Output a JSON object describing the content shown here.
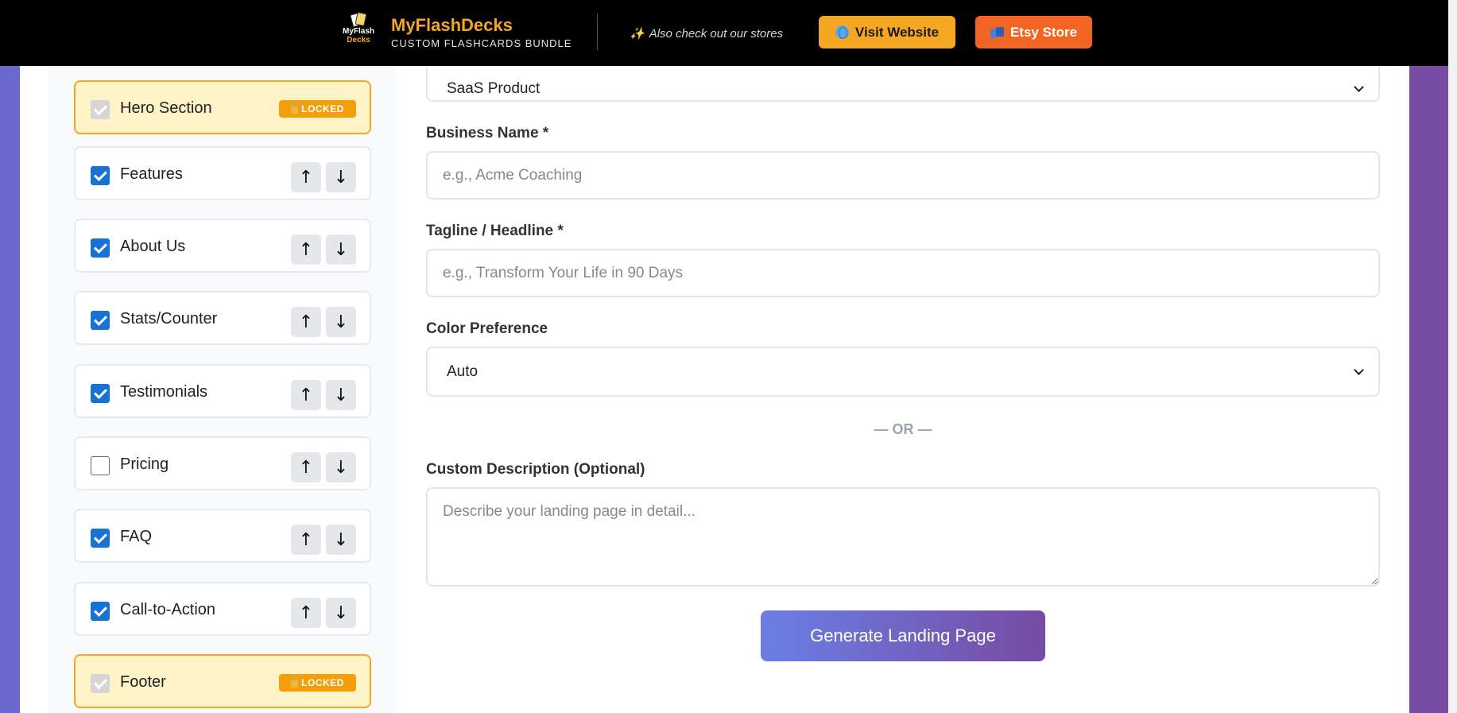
{
  "header": {
    "logo_line1": "MyFlash",
    "logo_line2": "Decks",
    "brand_name": "MyFlashDecks",
    "brand_sub": "CUSTOM FLASHCARDS BUNDLE",
    "also_check": "Also check out our stores",
    "visit_label": "Visit Website",
    "etsy_label": "Etsy Store"
  },
  "sections": [
    {
      "label": "Hero Section",
      "locked": true,
      "checked": true
    },
    {
      "label": "Features",
      "locked": false,
      "checked": true
    },
    {
      "label": "About Us",
      "locked": false,
      "checked": true
    },
    {
      "label": "Stats/Counter",
      "locked": false,
      "checked": true
    },
    {
      "label": "Testimonials",
      "locked": false,
      "checked": true
    },
    {
      "label": "Pricing",
      "locked": false,
      "checked": false
    },
    {
      "label": "FAQ",
      "locked": false,
      "checked": true
    },
    {
      "label": "Call-to-Action",
      "locked": false,
      "checked": true
    },
    {
      "label": "Footer",
      "locked": true,
      "checked": true
    }
  ],
  "locked_badge": "LOCKED",
  "arrow_up": "↑",
  "arrow_down": "↓",
  "form": {
    "type_value": "SaaS Product",
    "business_label": "Business Name *",
    "business_placeholder": "e.g., Acme Coaching",
    "tagline_label": "Tagline / Headline *",
    "tagline_placeholder": "e.g., Transform Your Life in 90 Days",
    "color_label": "Color Preference",
    "color_value": "Auto",
    "or_text": "— OR —",
    "custom_label": "Custom Description (Optional)",
    "custom_placeholder": "Describe your landing page in detail...",
    "generate_label": "Generate Landing Page"
  },
  "colors": {
    "accent_orange": "#f5a623",
    "etsy_orange": "#f26522",
    "checkbox_blue": "#1672d6",
    "gradient_start": "#6b7fe6",
    "gradient_end": "#764ba2"
  }
}
